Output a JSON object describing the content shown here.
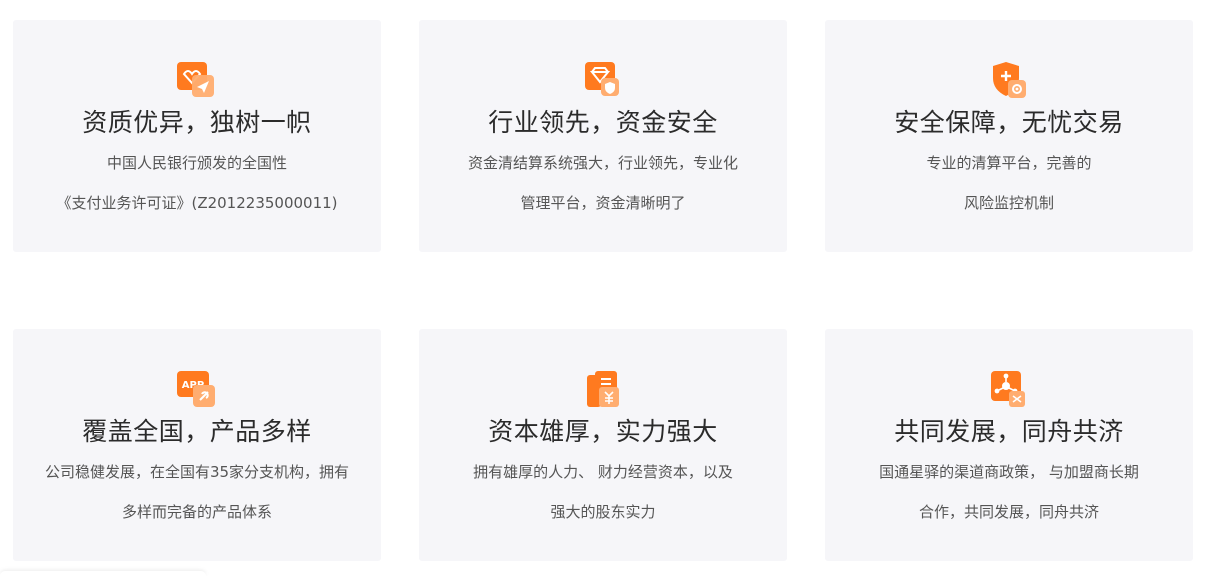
{
  "colors": {
    "card_bg": "#f6f6f9",
    "accent": "#ff7a1f",
    "accent_light": "#ffad70",
    "title": "#2b2b2b",
    "desc": "#555555"
  },
  "cards": [
    {
      "icon": "certificate-icon",
      "title": "资质优异，独树一帜",
      "line1": "中国人民银行颁发的全国性",
      "line2": "《支付业务许可证》(Z2012235000011)"
    },
    {
      "icon": "diamond-shield-icon",
      "title": "行业领先，资金安全",
      "line1": "资金清结算系统强大，行业领先，专业化",
      "line2": "管理平台，资金清晰明了"
    },
    {
      "icon": "shield-gear-icon",
      "title": "安全保障，无忧交易",
      "line1": "专业的清算平台，完善的",
      "line2": "风险监控机制"
    },
    {
      "icon": "app-icon",
      "app_label": "APP",
      "title": "覆盖全国，产品多样",
      "line1": "公司稳健发展，在全国有35家分支机构，拥有",
      "line2": "多样而完备的产品体系"
    },
    {
      "icon": "capital-document-icon",
      "title": "资本雄厚，实力强大",
      "line1": "拥有雄厚的人力、 财力经营资本，以及",
      "line2": "强大的股东实力"
    },
    {
      "icon": "network-partner-icon",
      "title": "共同发展，同舟共济",
      "line1": "国通星驿的渠道商政策， 与加盟商长期",
      "line2": "合作，共同发展，同舟共济"
    }
  ]
}
